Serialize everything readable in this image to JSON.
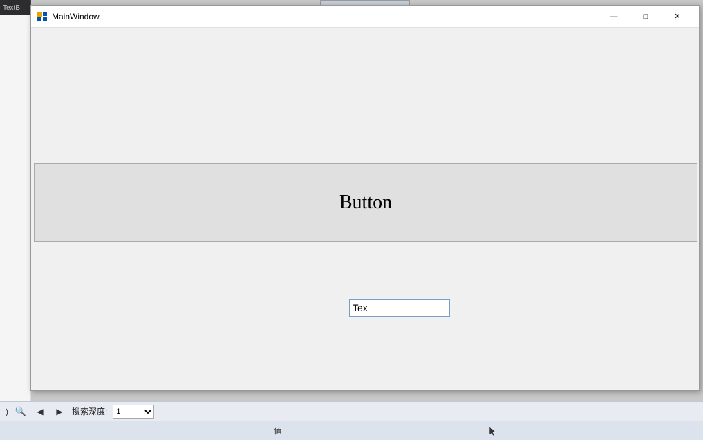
{
  "titleBar": {
    "title": "MainWindow",
    "iconLabel": "wpf-icon",
    "minimizeLabel": "—",
    "maximizeLabel": "□",
    "closeLabel": "✕"
  },
  "mainContent": {
    "bigButton": {
      "label": "Button"
    },
    "textInput": {
      "value": "Tex",
      "placeholder": ""
    }
  },
  "bottomToolbar": {
    "backLabel": "◀",
    "forwardLabel": "▶",
    "searchDepthLabel": "搜索深度:",
    "valueLabel": "值"
  },
  "partialWindow": {
    "tabLabel": "TextB"
  }
}
